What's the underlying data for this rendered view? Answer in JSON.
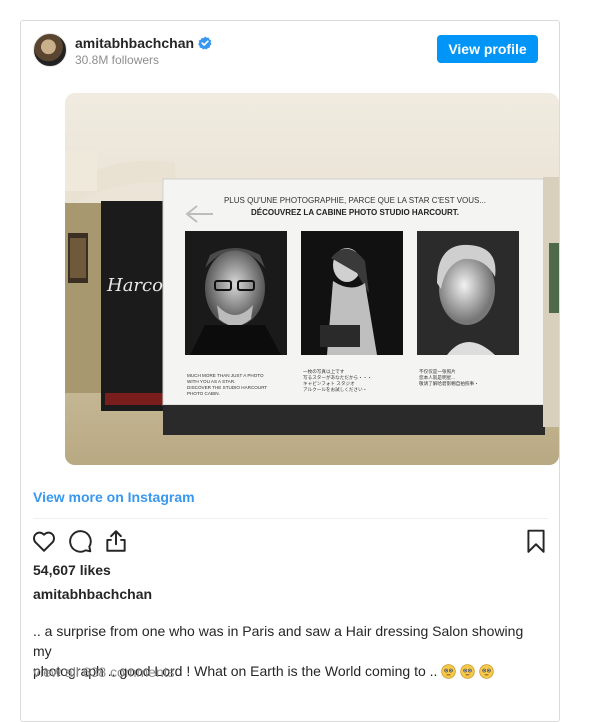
{
  "post": {
    "username": "amitabhbachchan",
    "followers": "30.8M followers",
    "view_profile_label": "View profile",
    "view_more_label": "View more on Instagram",
    "likes": "54,607 likes",
    "author": "amitabhbachchan",
    "caption_line1": ".. a surprise from one who was in Paris and saw a Hair dressing Salon showing my",
    "caption_line2": "photograph .. good Lord ! What on Earth is the World coming to ..",
    "comments_label": "view all 638 comments",
    "accent_color": "#0095f6",
    "link_color": "#3897f0"
  },
  "photo": {
    "heading_line1": "PLUS QU'UNE PHOTOGRAPHIE, PARCE QUE LA STAR C'EST VOUS...",
    "heading_line2": "DÉCOUVREZ LA CABINE PHOTO STUDIO HARCOURT.",
    "sign_text": "Harcou",
    "caption_left": [
      "MUCH MORE THAN JUST A PHOTO",
      "WITH YOU AS A STAR.",
      "DISCOVER THE STUDIO HARCOURT",
      "PHOTO CABIN."
    ],
    "caption_mid": [
      "一枚の写真以上です",
      "写るスターがあなただから・・・",
      "キャビンフォト スタジオ",
      "アルクールをお試しください・"
    ],
    "caption_right": [
      "不仅仅是一张照片",
      "您本人就是明星...",
      "敬请了解哈碧影棚自拍照事・"
    ]
  },
  "icons": [
    "heart-icon",
    "comment-icon",
    "share-icon",
    "bookmark-icon",
    "verified-badge-icon"
  ]
}
